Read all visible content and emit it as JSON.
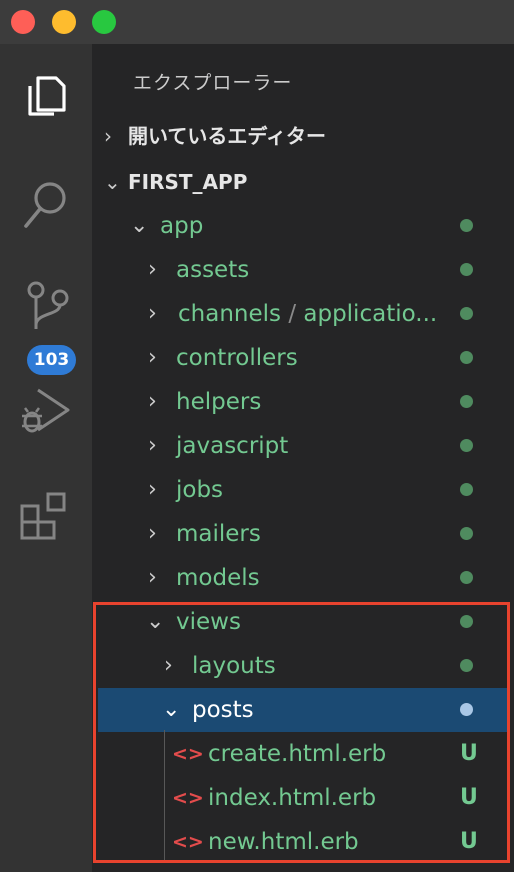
{
  "explorer": {
    "title": "エクスプローラー"
  },
  "sections": {
    "open_editors": "開いているエディター",
    "workspace": "FIRST_APP"
  },
  "activity_bar": {
    "icons": [
      "files-icon",
      "search-icon",
      "source-control-icon",
      "run-debug-icon",
      "extensions-icon"
    ],
    "source_control_badge": "103"
  },
  "tree": {
    "app": "app",
    "assets": "assets",
    "channels": "channels",
    "channels_sep": "/",
    "channels_child": "applicatio...",
    "controllers": "controllers",
    "helpers": "helpers",
    "javascript": "javascript",
    "jobs": "jobs",
    "mailers": "mailers",
    "models": "models",
    "views": "views",
    "layouts": "layouts",
    "posts": "posts",
    "files": [
      {
        "name": "create.html.erb",
        "status": "U"
      },
      {
        "name": "index.html.erb",
        "status": "U"
      },
      {
        "name": "new.html.erb",
        "status": "U"
      }
    ]
  },
  "colors": {
    "untracked_green": "#73c991",
    "highlight_red": "#e8432e",
    "selection_blue": "#1b4a73"
  }
}
